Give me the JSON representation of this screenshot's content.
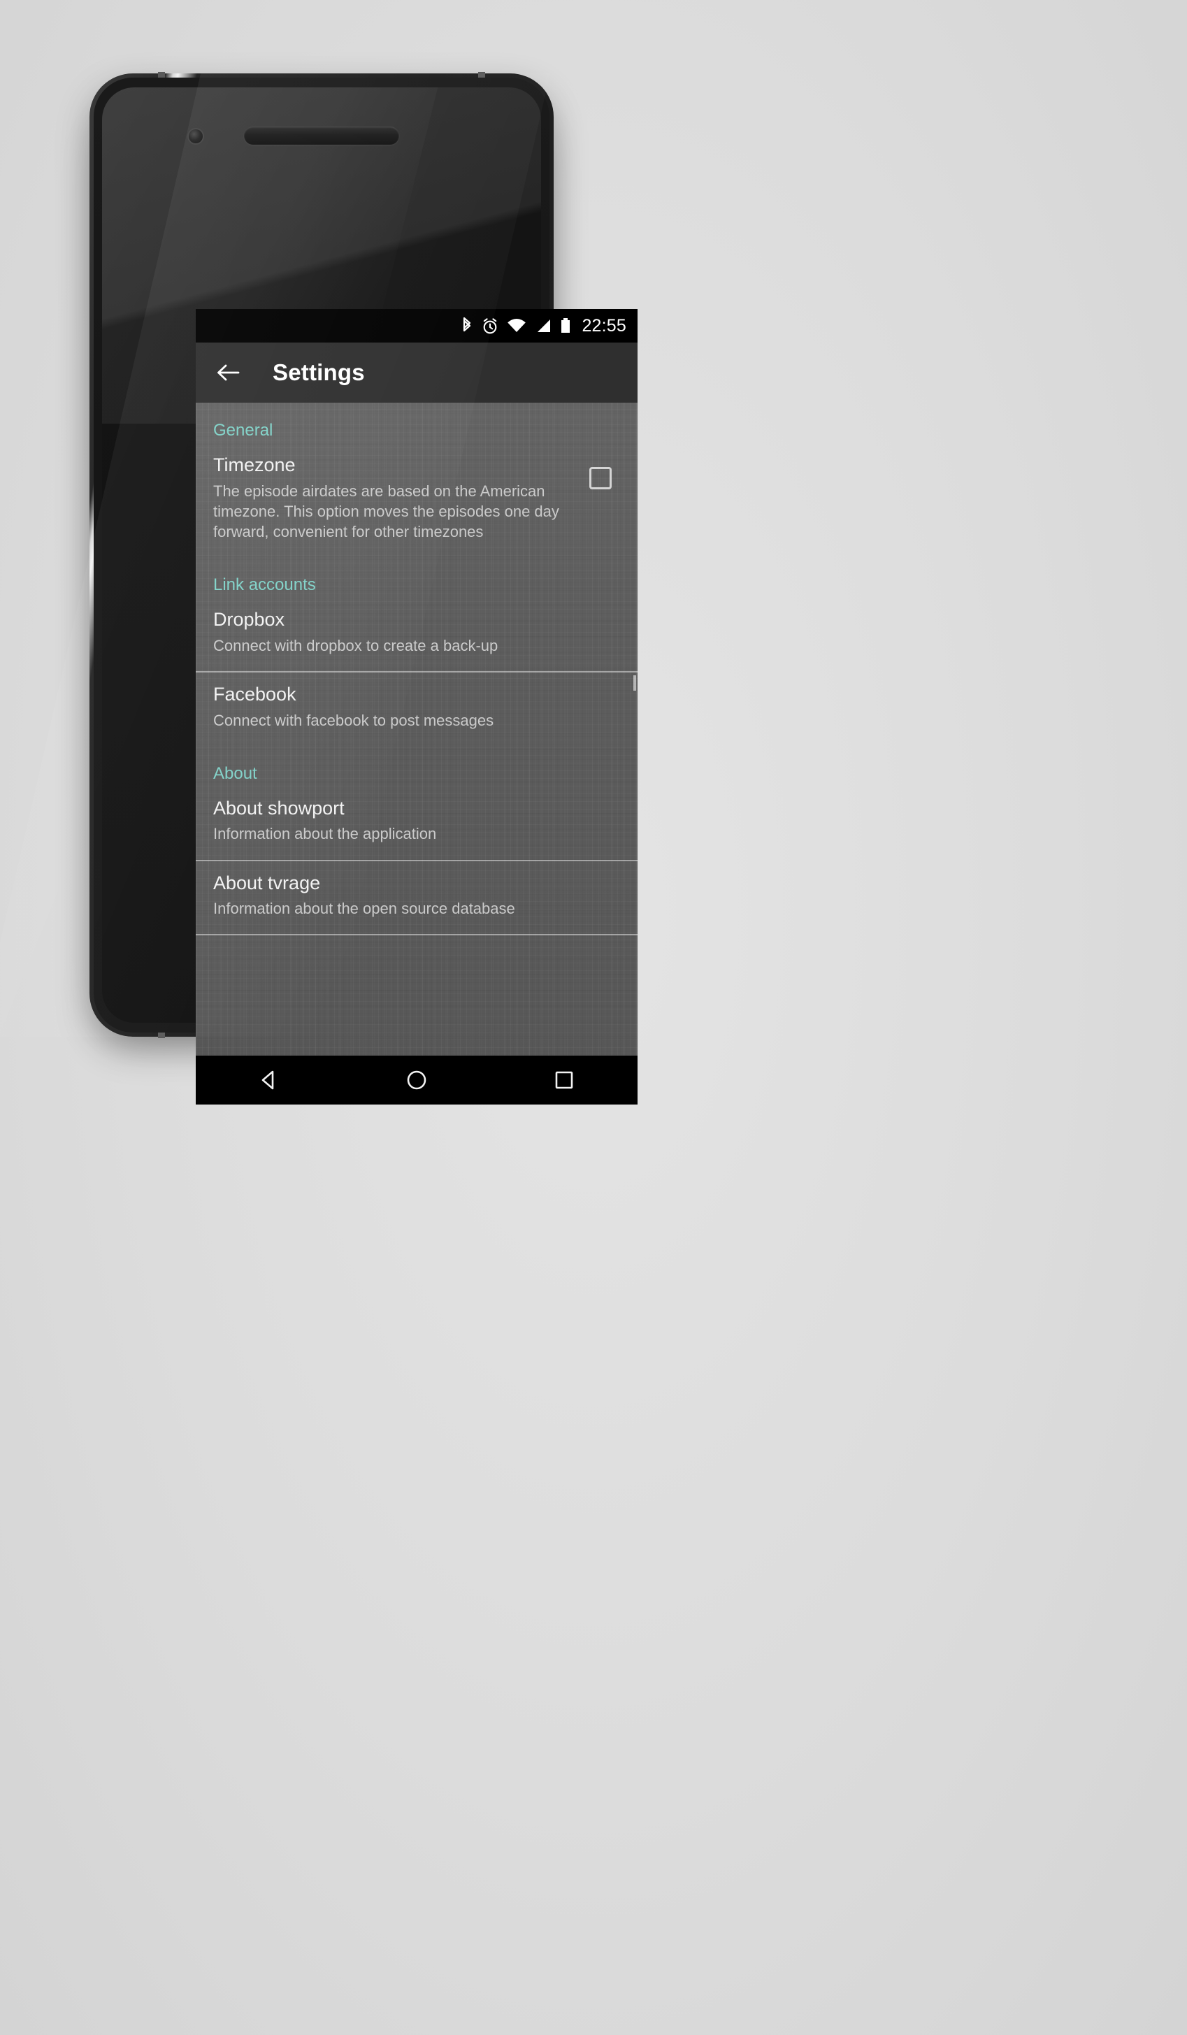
{
  "device": {
    "hardware": {
      "earpiece": "earpiece-speaker",
      "front_camera": "front-camera",
      "bottom_speaker": "bottom-speaker",
      "power_button": "power-button",
      "volume_button": "volume-button"
    }
  },
  "status_bar": {
    "time": "22:55",
    "icons": [
      "bluetooth-icon",
      "alarm-icon",
      "wifi-icon",
      "cellular-signal-icon",
      "battery-icon"
    ]
  },
  "toolbar": {
    "back_icon": "back-arrow-icon",
    "title": "Settings"
  },
  "colors": {
    "accent_teal": "#80d2c8",
    "toolbar_bg": "#2f2f2f",
    "content_bg": "#5b5b5b",
    "title_text": "#f2f2f2",
    "subtitle_text": "#cacaca",
    "statusbar_bg": "#000000",
    "navbar_bg": "#000000",
    "page_bg": "#dedede"
  },
  "sections": [
    {
      "header": "General",
      "items": [
        {
          "title": "Timezone",
          "subtitle": "The episode airdates are based on the American timezone. This option moves the episodes one day forward, convenient for other timezones",
          "control": "checkbox",
          "checked": false
        }
      ]
    },
    {
      "header": "Link accounts",
      "items": [
        {
          "title": "Dropbox",
          "subtitle": "Connect with dropbox to create a back-up",
          "control": "none"
        },
        {
          "title": "Facebook",
          "subtitle": "Connect with facebook to post messages",
          "control": "none"
        }
      ]
    },
    {
      "header": "About",
      "items": [
        {
          "title": "About showport",
          "subtitle": "Information about the application",
          "control": "none"
        },
        {
          "title": "About tvrage",
          "subtitle": "Information about the open source database",
          "control": "none"
        }
      ]
    }
  ],
  "nav_bar": {
    "back": "nav-back-icon",
    "home": "nav-home-icon",
    "recents": "nav-recents-icon"
  }
}
